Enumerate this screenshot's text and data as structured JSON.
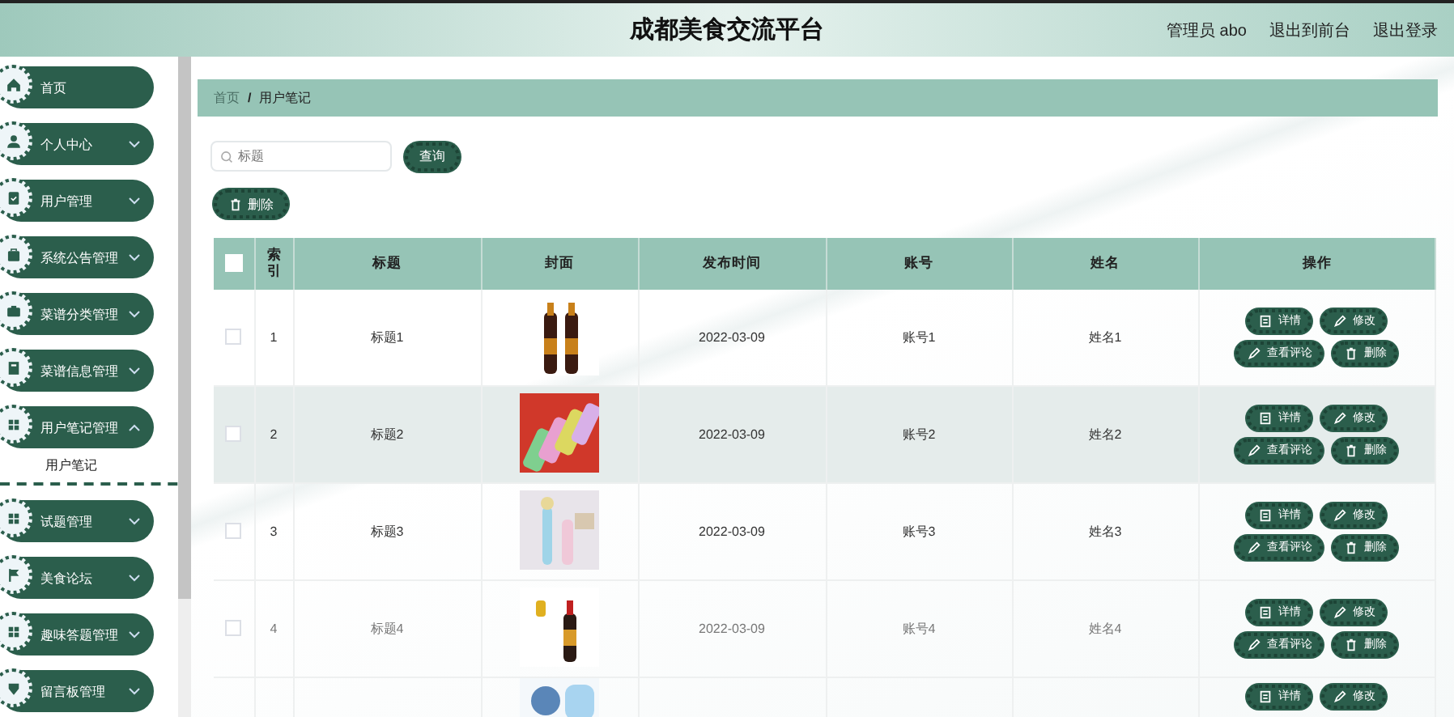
{
  "header": {
    "title": "成都美食交流平台",
    "user": "管理员 abo",
    "links": [
      "退出到前台",
      "退出登录"
    ]
  },
  "sidebar": {
    "items": [
      {
        "label": "首页"
      },
      {
        "label": "个人中心",
        "expanded": false
      },
      {
        "label": "用户管理",
        "expanded": false
      },
      {
        "label": "系统公告管理",
        "expanded": false
      },
      {
        "label": "菜谱分类管理",
        "expanded": false
      },
      {
        "label": "菜谱信息管理",
        "expanded": false
      },
      {
        "label": "用户笔记管理",
        "expanded": true,
        "children": [
          {
            "label": "用户笔记",
            "selected": true
          }
        ]
      },
      {
        "label": "试题管理",
        "expanded": false
      },
      {
        "label": "美食论坛",
        "expanded": false
      },
      {
        "label": "趣味答题管理",
        "expanded": false
      },
      {
        "label": "留言板管理",
        "expanded": false
      }
    ]
  },
  "breadcrumb": {
    "items": [
      "首页",
      "用户笔记"
    ],
    "separator": "/"
  },
  "search": {
    "placeholder": "标题",
    "button": "查询"
  },
  "delete_button": "删除",
  "table": {
    "header_checked": false,
    "columns": [
      "索引",
      "标题",
      "封面",
      "发布时间",
      "账号",
      "姓名",
      "操作"
    ],
    "rows": [
      {
        "checked": false,
        "highlighted": false,
        "index": "1",
        "title": "标题1",
        "cover": {
          "kind": "picture"
        },
        "date": "2022-03-09",
        "account": "账号1",
        "name": "姓名1",
        "actions": [
          {
            "kind": "detail",
            "label": "详情"
          },
          {
            "kind": "edit",
            "label": "修改"
          },
          {
            "kind": "comments",
            "label": "查看评论"
          },
          {
            "kind": "delete",
            "label": "删除"
          }
        ]
      },
      {
        "checked": false,
        "highlighted": true,
        "index": "2",
        "title": "标题2",
        "cover": {
          "kind": "picture"
        },
        "date": "2022-03-09",
        "account": "账号2",
        "name": "姓名2",
        "actions": [
          {
            "kind": "detail",
            "label": "详情"
          },
          {
            "kind": "edit",
            "label": "修改"
          },
          {
            "kind": "comments",
            "label": "查看评论"
          },
          {
            "kind": "delete",
            "label": "删除"
          }
        ]
      },
      {
        "checked": false,
        "highlighted": false,
        "index": "3",
        "title": "标题3",
        "cover": {
          "kind": "picture"
        },
        "date": "2022-03-09",
        "account": "账号3",
        "name": "姓名3",
        "actions": [
          {
            "kind": "detail",
            "label": "详情"
          },
          {
            "kind": "edit",
            "label": "修改"
          },
          {
            "kind": "comments",
            "label": "查看评论"
          },
          {
            "kind": "delete",
            "label": "删除"
          }
        ]
      },
      {
        "checked": false,
        "highlighted": false,
        "index": "4",
        "title": "标题4",
        "cover": {
          "kind": "picture"
        },
        "date": "2022-03-09",
        "account": "账号4",
        "name": "姓名4",
        "actions": [
          {
            "kind": "detail",
            "label": "详情"
          },
          {
            "kind": "edit",
            "label": "修改"
          },
          {
            "kind": "comments",
            "label": "查看评论"
          },
          {
            "kind": "delete",
            "label": "删除"
          }
        ]
      },
      {
        "cover": {
          "kind": "picture"
        },
        "actions": [
          {
            "kind": "detail",
            "label": "详情"
          },
          {
            "kind": "edit",
            "label": "修改"
          }
        ]
      }
    ]
  }
}
